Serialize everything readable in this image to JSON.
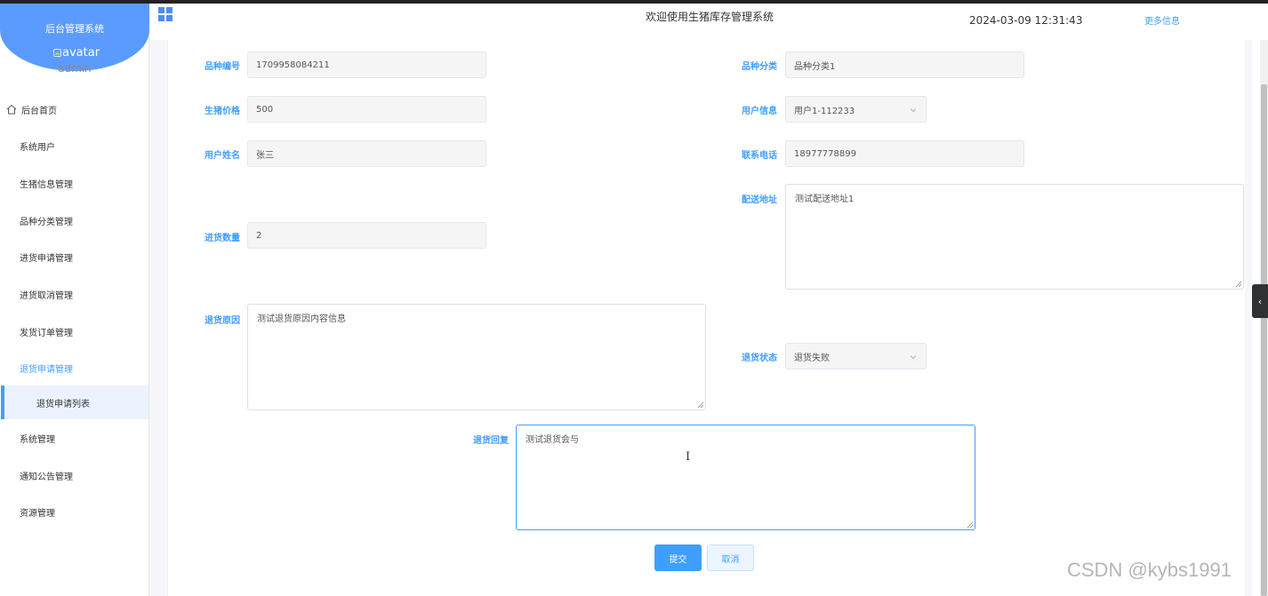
{
  "sidebar": {
    "brand": "后台管理系统",
    "avatar_alt": "avatar",
    "username": "admin",
    "items": [
      {
        "label": "后台首页"
      },
      {
        "label": "系统用户"
      },
      {
        "label": "生猪信息管理"
      },
      {
        "label": "品种分类管理"
      },
      {
        "label": "进货申请管理"
      },
      {
        "label": "进货取消管理"
      },
      {
        "label": "发货订单管理"
      },
      {
        "label": "退货申请管理"
      },
      {
        "label": "退货申请列表"
      },
      {
        "label": "系统管理"
      },
      {
        "label": "通知公告管理"
      },
      {
        "label": "资源管理"
      }
    ]
  },
  "header": {
    "title": "欢迎使用生猪库存管理系统",
    "datetime": "2024-03-09 12:31:43",
    "more_info": "更多信息"
  },
  "form": {
    "breed_no": {
      "label": "品种编号",
      "value": "1709958084211"
    },
    "breed_category": {
      "label": "品种分类",
      "value": "品种分类1"
    },
    "pig_price": {
      "label": "生猪价格",
      "value": "500"
    },
    "user_info": {
      "label": "用户信息",
      "value": "用户1-112233"
    },
    "user_name": {
      "label": "用户姓名",
      "value": "张三"
    },
    "phone": {
      "label": "联系电话",
      "value": "18977778899"
    },
    "delivery_address": {
      "label": "配送地址",
      "value": "测试配送地址1"
    },
    "purchase_qty": {
      "label": "进货数量",
      "value": "2"
    },
    "return_reason": {
      "label": "退货原因",
      "value": "测试退货原因内容信息"
    },
    "return_status": {
      "label": "退货状态",
      "value": "退货失败"
    },
    "return_reply": {
      "label": "退货回复",
      "value": "测试退货会与"
    }
  },
  "buttons": {
    "submit": "提交",
    "cancel": "取消"
  },
  "watermark": "CSDN @kybs1991",
  "colors": {
    "accent": "#409eff",
    "sidebar_header": "#5b9bff"
  }
}
